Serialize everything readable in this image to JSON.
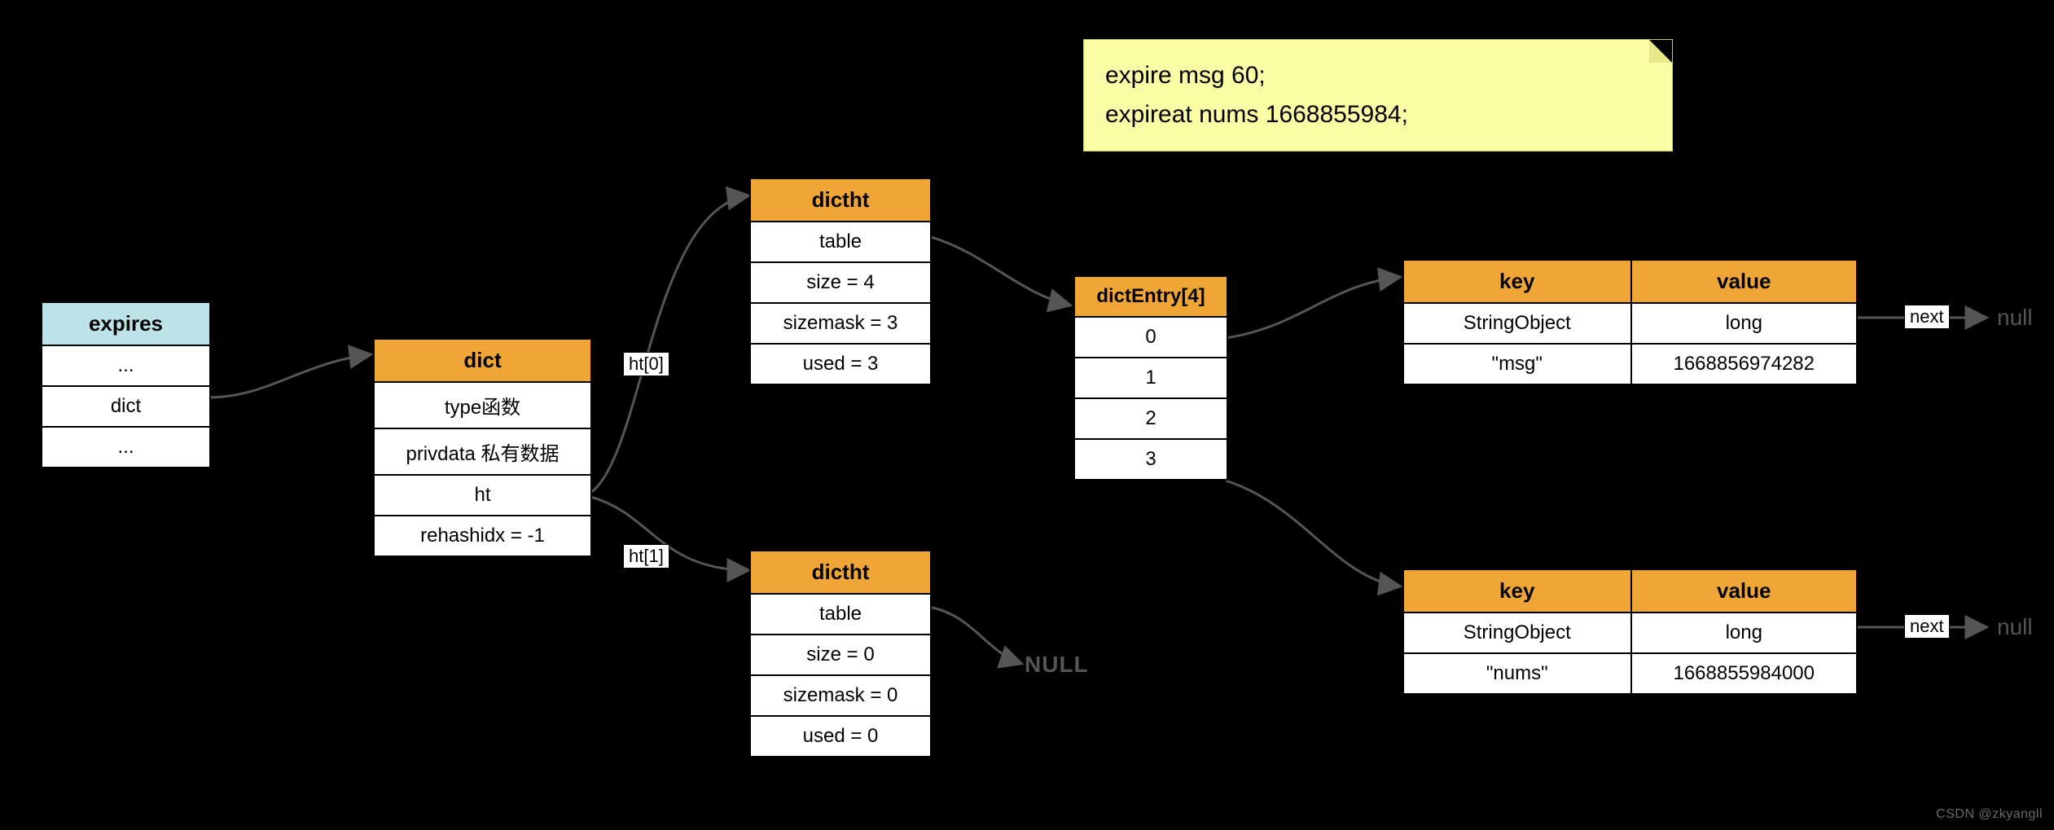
{
  "note": {
    "line1": "expire msg 60;",
    "line2": "expireat nums 1668855984;"
  },
  "expires": {
    "title": "expires",
    "rows": [
      "...",
      "dict",
      "..."
    ]
  },
  "dict": {
    "title": "dict",
    "rows": [
      "type函数",
      "privdata 私有数据",
      "ht",
      "rehashidx = -1"
    ]
  },
  "ht_labels": {
    "ht0": "ht[0]",
    "ht1": "ht[1]"
  },
  "dictht0": {
    "title": "dictht",
    "rows": [
      "table",
      "size = 4",
      "sizemask = 3",
      "used = 3"
    ]
  },
  "dictht1": {
    "title": "dictht",
    "rows": [
      "table",
      "size = 0",
      "sizemask = 0",
      "used = 0"
    ]
  },
  "null_label": "NULL",
  "dictEntry": {
    "title": "dictEntry[4]",
    "rows": [
      "0",
      "1",
      "2",
      "3"
    ]
  },
  "entry0": {
    "key_h": "key",
    "val_h": "value",
    "key_t": "StringObject",
    "val_t": "long",
    "key_v": "\"msg\"",
    "val_v": "1668856974282"
  },
  "entry1": {
    "key_h": "key",
    "val_h": "value",
    "key_t": "StringObject",
    "val_t": "long",
    "key_v": "\"nums\"",
    "val_v": "1668855984000"
  },
  "next_label": "next",
  "null_text": "null",
  "watermark": "CSDN @zkyangll"
}
